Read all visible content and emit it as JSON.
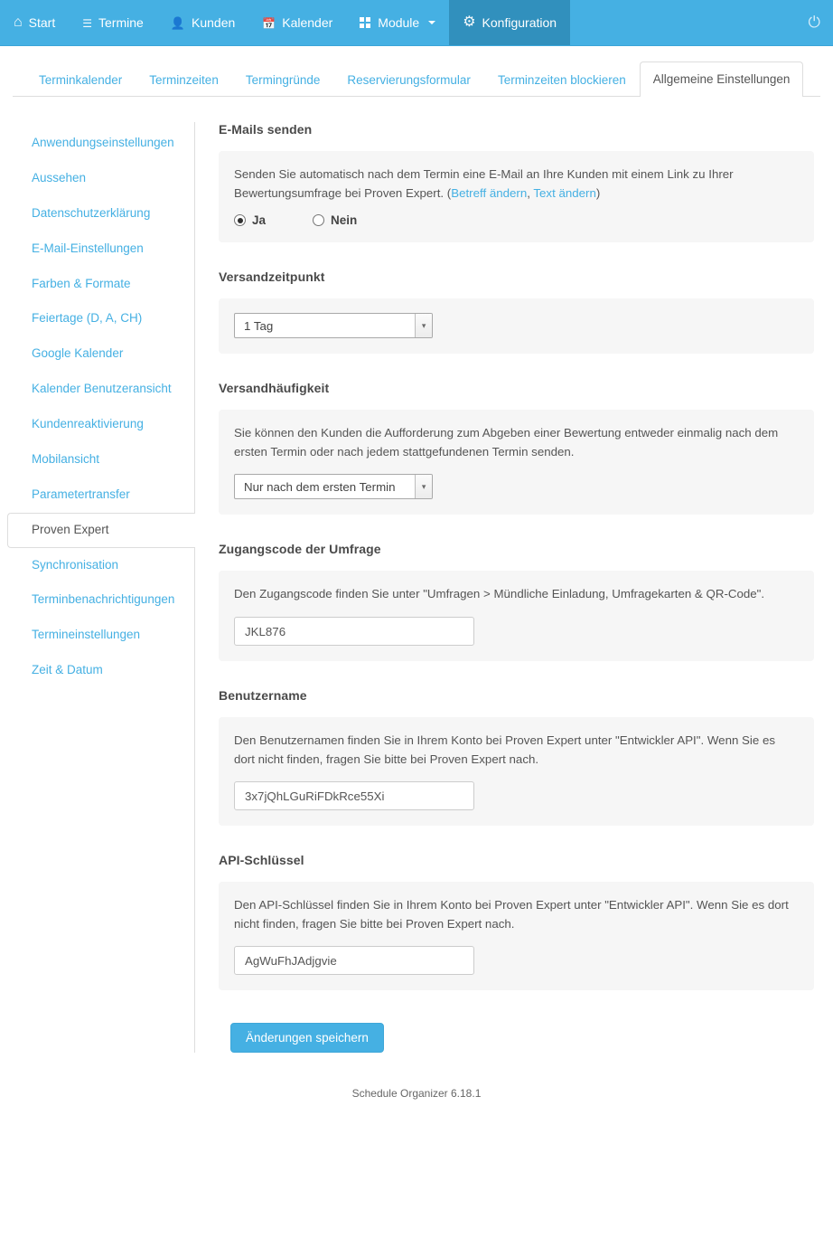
{
  "navbar": {
    "items": [
      {
        "label": "Start",
        "icon": "home-icon",
        "active": false
      },
      {
        "label": "Termine",
        "icon": "list-icon",
        "active": false
      },
      {
        "label": "Kunden",
        "icon": "user-icon",
        "active": false
      },
      {
        "label": "Kalender",
        "icon": "calendar-icon",
        "active": false
      },
      {
        "label": "Module",
        "icon": "grid-icon",
        "active": false,
        "caret": true
      },
      {
        "label": "Konfiguration",
        "icon": "gears-icon",
        "active": true
      }
    ],
    "logout_icon": "power-icon",
    "bg_color": "#45b0e3",
    "active_bg_color": "#3190bd"
  },
  "tabs": [
    {
      "label": "Terminkalender",
      "active": false
    },
    {
      "label": "Terminzeiten",
      "active": false
    },
    {
      "label": "Termingründe",
      "active": false
    },
    {
      "label": "Reservierungsformular",
      "active": false
    },
    {
      "label": "Terminzeiten blockieren",
      "active": false
    },
    {
      "label": "Allgemeine Einstellungen",
      "active": true
    }
  ],
  "sidebar": {
    "items": [
      {
        "label": "Anwendungseinstellungen",
        "active": false
      },
      {
        "label": "Aussehen",
        "active": false
      },
      {
        "label": "Datenschutzerklärung",
        "active": false
      },
      {
        "label": "E-Mail-Einstellungen",
        "active": false
      },
      {
        "label": "Farben & Formate",
        "active": false
      },
      {
        "label": "Feiertage (D, A, CH)",
        "active": false
      },
      {
        "label": "Google Kalender",
        "active": false
      },
      {
        "label": "Kalender Benutzeransicht",
        "active": false
      },
      {
        "label": "Kundenreaktivierung",
        "active": false
      },
      {
        "label": "Mobilansicht",
        "active": false
      },
      {
        "label": "Parametertransfer",
        "active": false
      },
      {
        "label": "Proven Expert",
        "active": true
      },
      {
        "label": "Synchronisation",
        "active": false
      },
      {
        "label": "Terminbenachrichtigungen",
        "active": false
      },
      {
        "label": "Termineinstellungen",
        "active": false
      },
      {
        "label": "Zeit & Datum",
        "active": false
      }
    ],
    "link_color": "#45b0e3"
  },
  "sections": {
    "emails": {
      "title": "E-Mails senden",
      "description_part1": "Senden Sie automatisch nach dem Termin eine E-Mail an Ihre Kunden mit einem Link zu Ihrer Bewertungsumfrage bei Proven Expert. (",
      "link_subject": "Betreff ändern",
      "separator": ", ",
      "link_text": "Text ändern",
      "description_part2": ")",
      "radio_yes": "Ja",
      "radio_no": "Nein",
      "selected": "Ja"
    },
    "send_time": {
      "title": "Versandzeitpunkt",
      "select_value": "1 Tag"
    },
    "frequency": {
      "title": "Versandhäufigkeit",
      "description": "Sie können den Kunden die Aufforderung zum Abgeben einer Bewertung entweder einmalig nach dem ersten Termin oder nach jedem stattgefundenen Termin senden.",
      "select_value": "Nur nach dem ersten Termin"
    },
    "access_code": {
      "title": "Zugangscode der Umfrage",
      "description": "Den Zugangscode finden Sie unter \"Umfragen > Mündliche Einladung, Umfragekarten & QR-Code\".",
      "input_value": "JKL876"
    },
    "username": {
      "title": "Benutzername",
      "description": "Den Benutzernamen finden Sie in Ihrem Konto bei Proven Expert unter \"Entwickler API\". Wenn Sie es dort nicht finden, fragen Sie bitte bei Proven Expert nach.",
      "input_value": "3x7jQhLGuRiFDkRce55Xi"
    },
    "api_key": {
      "title": "API-Schlüssel",
      "description": "Den API-Schlüssel finden Sie in Ihrem Konto bei Proven Expert unter \"Entwickler API\". Wenn Sie es dort nicht finden, fragen Sie bitte bei Proven Expert nach.",
      "input_value": "AgWuFhJAdjgvie"
    }
  },
  "save_button": "Änderungen speichern",
  "footer": "Schedule Organizer 6.18.1"
}
